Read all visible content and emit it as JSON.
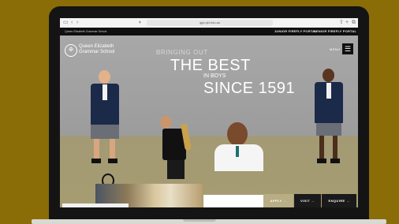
{
  "browser": {
    "url": "qgs.qld.edu.au"
  },
  "topbar": {
    "school_link": "Queen Elizabeth Grammar School",
    "junior_portal": "JUNIOR FIREFLY PORTAL",
    "senior_portal": "SENIOR FIREFLY PORTAL"
  },
  "header": {
    "logo_line1": "Queen Elizabeth",
    "logo_line2": "Grammar School",
    "menu_label": "MENU"
  },
  "hero": {
    "line1": "BRINGING OUT",
    "line2": "THE BEST",
    "line3": "IN BOYS",
    "line4": "SINCE 1591"
  },
  "cta": {
    "apply": "APPLY →",
    "visit": "VISIT →",
    "enquire": "ENQUIRE →"
  },
  "colors": {
    "background": "#8a6d07",
    "hero_wall": "#a3a3a3",
    "hero_floor": "#a69c72",
    "uniform_blazer": "#1c2a4a"
  }
}
